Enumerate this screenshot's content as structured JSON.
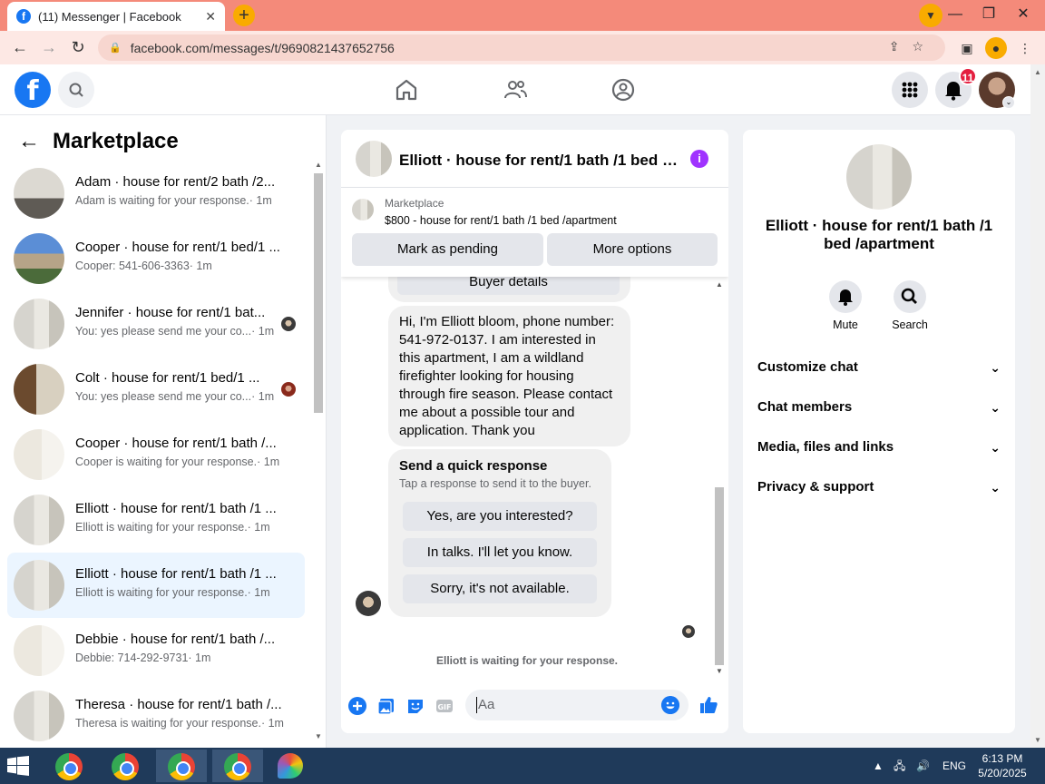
{
  "browser": {
    "tab_title": "(11) Messenger | Facebook",
    "url": "facebook.com/messages/t/9690821437652756"
  },
  "fb": {
    "notifications_count": "11"
  },
  "sidebar": {
    "title": "Marketplace",
    "conversations": [
      {
        "name": "Adam · house for rent/2 bath /2...",
        "preview": "Adam is waiting for your response.",
        "time": "· 1m",
        "thumb": "room-dark"
      },
      {
        "name": "Cooper · house for rent/1 bed/1 ...",
        "preview": "Cooper: 541-606-3363",
        "time": "· 1m",
        "thumb": "bldg"
      },
      {
        "name": "Jennifer · house for rent/1 bat...",
        "preview": "You: yes please send me your co...",
        "time": "· 1m",
        "thumb": "room-bath"
      },
      {
        "name": "Colt · house for rent/1 bed/1 ...",
        "preview": "You: yes please send me your co...",
        "time": "· 1m",
        "thumb": "kitchen"
      },
      {
        "name": "Cooper · house for rent/1 bath /...",
        "preview": "Cooper is waiting for your response.",
        "time": "· 1m",
        "thumb": "fireplace"
      },
      {
        "name": "Elliott · house for rent/1 bath /1 ...",
        "preview": "Elliott is waiting for your response.",
        "time": "· 1m",
        "thumb": "room-bath"
      },
      {
        "name": "Elliott · house for rent/1 bath /1 ...",
        "preview": "Elliott is waiting for your response.",
        "time": "· 1m",
        "thumb": "room-bath",
        "active": true
      },
      {
        "name": "Debbie · house for rent/1 bath /...",
        "preview": "Debbie: 714-292-9731",
        "time": "· 1m",
        "thumb": "fireplace"
      },
      {
        "name": "Theresa · house for rent/1 bath /...",
        "preview": "Theresa is waiting for your response.",
        "time": "· 1m",
        "thumb": "room-bath"
      }
    ]
  },
  "chat": {
    "title": "Elliott · house for rent/1 bath /1 bed /apartment",
    "marketplace_label": "Marketplace",
    "listing": "$800 - house for rent/1 bath /1 bed /apartment",
    "mark_pending": "Mark as pending",
    "more_options": "More options",
    "buyer_details": "Buyer details",
    "message": "Hi, I'm Elliott bloom, phone number: 541-972-0137. I am interested in this apartment, I am a wildland firefighter looking for housing through fire season. Please contact me about a possible tour and application. Thank you",
    "quick_title": "Send a quick response",
    "quick_sub": "Tap a response to send it to the buyer.",
    "quick_responses": [
      "Yes, are you interested?",
      "In talks. I'll let you know.",
      "Sorry, it's not available."
    ],
    "waiting": "Elliott is waiting for your response.",
    "input_placeholder": "Aa"
  },
  "rpanel": {
    "name": "Elliott · house for rent/1 bath /1 bed /apartment",
    "mute": "Mute",
    "search": "Search",
    "sections": [
      "Customize chat",
      "Chat members",
      "Media, files and links",
      "Privacy & support"
    ]
  },
  "taskbar": {
    "lang": "ENG",
    "time": "6:13 PM",
    "date": "5/20/2025"
  },
  "colors": {
    "fb_blue": "#1877f2",
    "chrome_tab_strip": "#f48a7a",
    "active_conv": "#ebf5ff",
    "info_purple": "#a033ff"
  }
}
